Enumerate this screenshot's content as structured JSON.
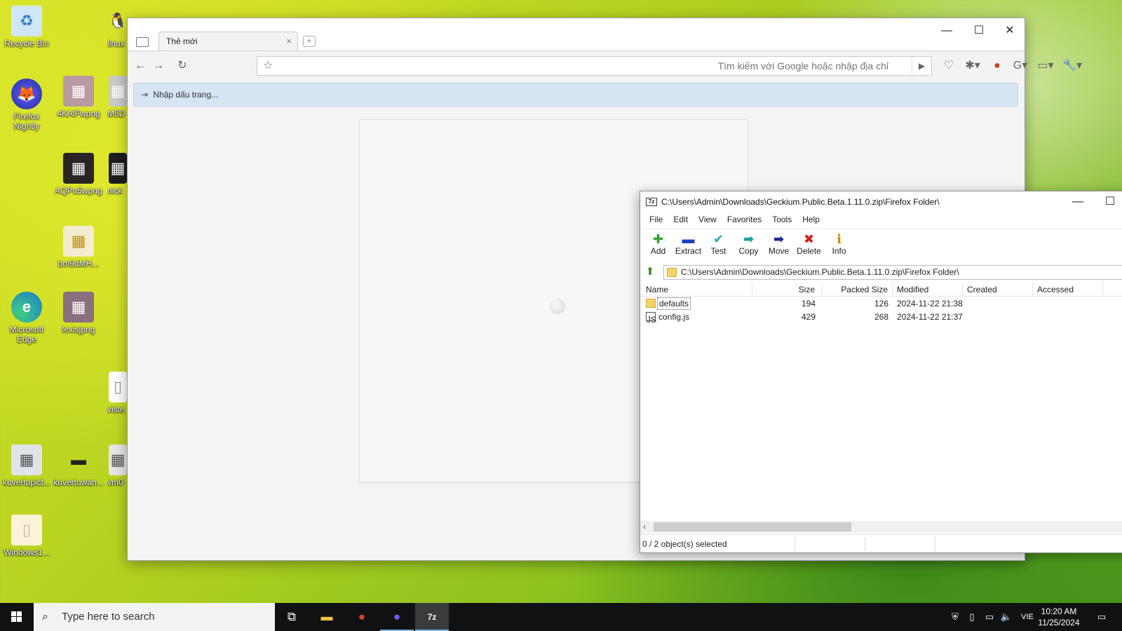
{
  "desktop": {
    "icons": [
      {
        "label": "Recycle Bin",
        "glyph": "♻"
      },
      {
        "label": "linux",
        "glyph": "🐧"
      },
      {
        "label": "Firefox Nightly",
        "glyph": "🦊"
      },
      {
        "label": "4KAlFwpng",
        "glyph": "▦"
      },
      {
        "label": "M5D",
        "glyph": "▦"
      },
      {
        "label": "AQPu5wpng",
        "glyph": "▦"
      },
      {
        "label": "nick",
        "glyph": "▦"
      },
      {
        "label": "bm9dMH...",
        "glyph": "▦"
      },
      {
        "label": "Microsoft Edge",
        "glyph": "e"
      },
      {
        "label": "lexisjpng",
        "glyph": "▦"
      },
      {
        "label": "viste",
        "glyph": "▯"
      },
      {
        "label": "kuvertupict...",
        "glyph": "▦"
      },
      {
        "label": "kuvertuwan...",
        "glyph": "▬"
      },
      {
        "label": "vm0",
        "glyph": "▦"
      },
      {
        "label": "Windows1...",
        "glyph": "▯"
      }
    ]
  },
  "browser": {
    "tab_title": "Thẻ mới",
    "tab_close": "×",
    "newtab": "+",
    "address_placeholder": "Tìm kiếm với Google hoặc nhập địa chỉ",
    "bookmarks_label": "Nhập dấu trang...",
    "window_controls": {
      "minimize": "—",
      "maximize": "☐",
      "close": "✕"
    }
  },
  "zip": {
    "title": "C:\\Users\\Admin\\Downloads\\Geckium.Public.Beta.1.11.0.zip\\Firefox Folder\\",
    "app_icon": "7z",
    "menu": [
      "File",
      "Edit",
      "View",
      "Favorites",
      "Tools",
      "Help"
    ],
    "toolbar": [
      {
        "label": "Add",
        "icon": "plus-icon",
        "glyph": "✚",
        "color": "#2fa52f"
      },
      {
        "label": "Extract",
        "icon": "minus-icon",
        "glyph": "▬",
        "color": "#1f3fbf"
      },
      {
        "label": "Test",
        "icon": "check-icon",
        "glyph": "✔",
        "color": "#1fb0b0"
      },
      {
        "label": "Copy",
        "icon": "arrow-right-icon",
        "glyph": "➡",
        "color": "#1f9f9f"
      },
      {
        "label": "Move",
        "icon": "arrow-right-icon",
        "glyph": "➡",
        "color": "#1a2d8f"
      },
      {
        "label": "Delete",
        "icon": "x-icon",
        "glyph": "✖",
        "color": "#d01f1f"
      },
      {
        "label": "Info",
        "icon": "info-icon",
        "glyph": "ℹ",
        "color": "#c98f00"
      }
    ],
    "path": "C:\\Users\\Admin\\Downloads\\Geckium.Public.Beta.1.11.0.zip\\Firefox Folder\\",
    "columns": [
      "Name",
      "Size",
      "Packed Size",
      "Modified",
      "Created",
      "Accessed"
    ],
    "rows": [
      {
        "name": "defaults",
        "type": "folder",
        "size": "194",
        "packed": "126",
        "modified": "2024-11-22 21:38",
        "created": "",
        "accessed": ""
      },
      {
        "name": "config.js",
        "type": "file",
        "size": "429",
        "packed": "268",
        "modified": "2024-11-22 21:37",
        "created": "",
        "accessed": ""
      }
    ],
    "status": "0 / 2 object(s) selected",
    "window_controls": {
      "minimize": "—",
      "maximize": "☐"
    }
  },
  "taskbar": {
    "search_placeholder": "Type here to search",
    "language": "VIE",
    "time": "10:20 AM",
    "date": "11/25/2024"
  }
}
